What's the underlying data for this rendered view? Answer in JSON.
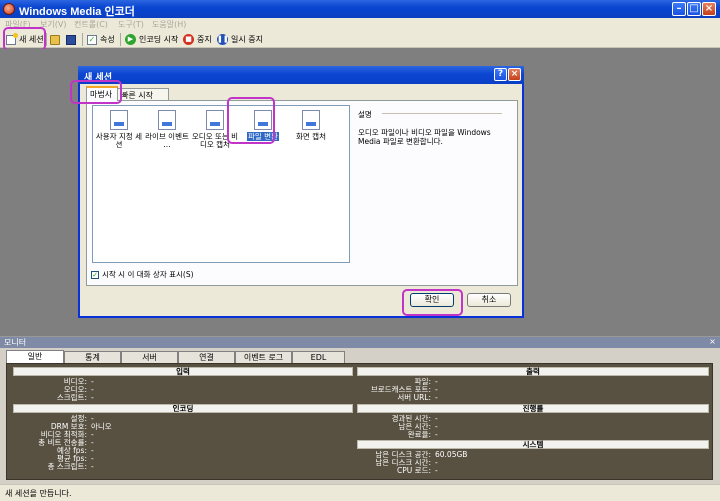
{
  "window": {
    "title": "Windows Media 인코더"
  },
  "menu": [
    "파일(F)",
    "보기(V)",
    "컨트롤(C)",
    "도구(T)",
    "도움말(H)"
  ],
  "toolbar": {
    "new_session": "새 세션",
    "properties": "속성",
    "start_encoding": "인코딩 시작",
    "stop": "중지",
    "pause": "일시 중지"
  },
  "dialog": {
    "title": "새 세션",
    "tabs": [
      "마법사",
      "빠른 시작"
    ],
    "items": [
      {
        "label": "사용자 지정 세션"
      },
      {
        "label": "라이브 이벤트 ..."
      },
      {
        "label": "오디오 또는 비디오 캡처"
      },
      {
        "label": "파일 변환",
        "selected": true
      },
      {
        "label": "화면 캡처"
      }
    ],
    "description_heading": "설명",
    "description": "오디오 파일이나 비디오 파일을 Windows Media 파일로 변환합니다.",
    "show_on_start": "시작 시 이 대화 상자 표시(S)",
    "show_on_start_checked": true,
    "ok": "확인",
    "cancel": "취소"
  },
  "monitor": {
    "title": "모니터",
    "tabs": [
      "일반",
      "통계",
      "서버",
      "연결",
      "이벤트 로그",
      "EDL"
    ],
    "sections": {
      "input": {
        "heading": "입력",
        "rows": [
          {
            "label": "비디오:",
            "value": "-"
          },
          {
            "label": "오디오:",
            "value": "-"
          },
          {
            "label": "스크립트:",
            "value": "-"
          }
        ]
      },
      "output": {
        "heading": "출력",
        "rows": [
          {
            "label": "파일:",
            "value": "-"
          },
          {
            "label": "브로드캐스트 포트:",
            "value": "-"
          },
          {
            "label": "서버 URL:",
            "value": "-"
          }
        ]
      },
      "encoding": {
        "heading": "인코딩",
        "rows": [
          {
            "label": "설정:",
            "value": "-"
          },
          {
            "label": "DRM 보호:",
            "value": "아니오"
          },
          {
            "label": "비디오 최적화:",
            "value": "-"
          },
          {
            "label": "총 비트 전송률:",
            "value": "-"
          },
          {
            "label": "예상 fps:",
            "value": "-"
          },
          {
            "label": "평균 fps:",
            "value": "-"
          },
          {
            "label": "총 스크립트:",
            "value": "-"
          }
        ]
      },
      "progress": {
        "heading": "진행률",
        "rows": [
          {
            "label": "경과된 시간:",
            "value": "-"
          },
          {
            "label": "남은 시간:",
            "value": "-"
          },
          {
            "label": "완료율:",
            "value": "-"
          }
        ]
      },
      "system": {
        "heading": "시스템",
        "rows": [
          {
            "label": "남은 디스크 공간:",
            "value": "60.05GB"
          },
          {
            "label": "남은 디스크 시간:",
            "value": "-"
          },
          {
            "label": "CPU 로드:",
            "value": "-"
          }
        ]
      }
    }
  },
  "status": "새 세션을 만듭니다."
}
